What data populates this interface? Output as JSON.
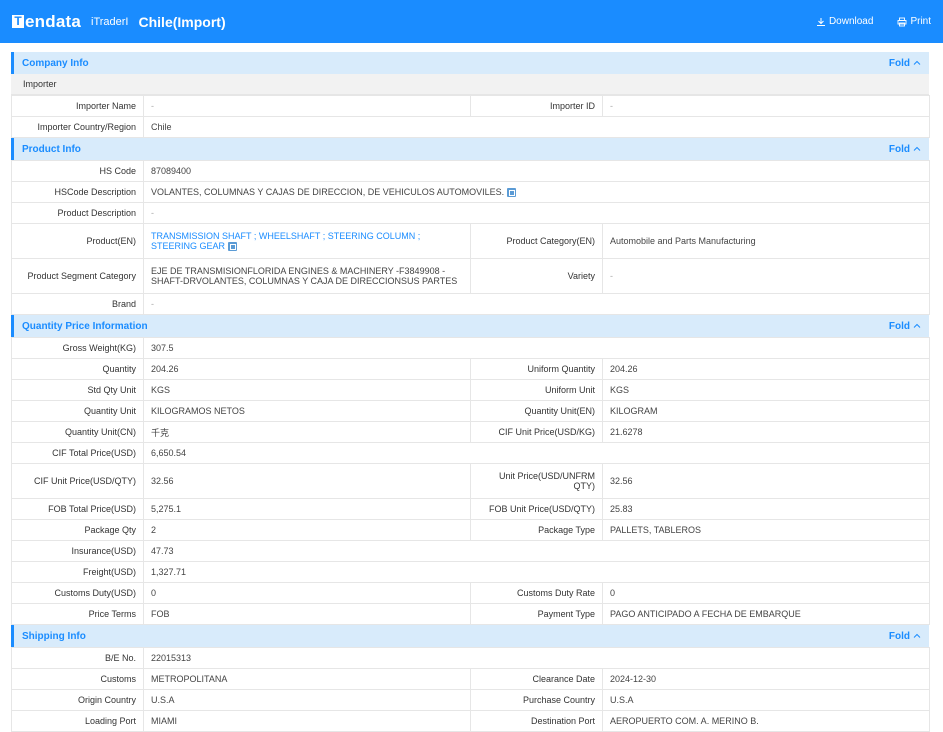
{
  "header": {
    "logo_mark": "T",
    "logo_text": "endata",
    "sub_brand": "iTraderI",
    "title": "Chile(Import)",
    "download": "Download",
    "print": "Print"
  },
  "fold_label": "Fold",
  "company": {
    "title": "Company Info",
    "subhead": "Importer",
    "rows": [
      {
        "l1": "Importer Name",
        "v1": "-",
        "l2": "Importer ID",
        "v2": "-"
      },
      {
        "l1": "Importer Country/Region",
        "v1": "Chile"
      }
    ]
  },
  "product": {
    "title": "Product Info",
    "hs_code_label": "HS Code",
    "hs_code": "87089400",
    "hs_desc_label": "HSCode Description",
    "hs_desc": "VOLANTES, COLUMNAS Y CAJAS DE DIRECCION, DE VEHICULOS AUTOMOVILES.",
    "prod_desc_label": "Product Description",
    "prod_desc": "-",
    "product_en_label": "Product(EN)",
    "product_en": "TRANSMISSION SHAFT ; WHEELSHAFT ; STEERING COLUMN ; STEERING GEAR",
    "category_en_label": "Product Category(EN)",
    "category_en": "Automobile and Parts Manufacturing",
    "segment_label": "Product Segment Category",
    "segment": "EJE DE TRANSMISIONFLORIDA ENGINES & MACHINERY -F3849908 -SHAFT-DRVOLANTES, COLUMNAS Y CAJA DE DIRECCIONSUS PARTES",
    "variety_label": "Variety",
    "variety": "-",
    "brand_label": "Brand",
    "brand": "-"
  },
  "quantity": {
    "title": "Quantity Price Information",
    "gross_weight_label": "Gross Weight(KG)",
    "gross_weight": "307.5",
    "quantity_label": "Quantity",
    "quantity": "204.26",
    "uniform_qty_label": "Uniform Quantity",
    "uniform_qty": "204.26",
    "std_unit_label": "Std Qty Unit",
    "std_unit": "KGS",
    "uniform_unit_label": "Uniform Unit",
    "uniform_unit": "KGS",
    "qty_unit_label": "Quantity Unit",
    "qty_unit": "KILOGRAMOS NETOS",
    "qty_unit_en_label": "Quantity Unit(EN)",
    "qty_unit_en": "KILOGRAM",
    "qty_unit_cn_label": "Quantity Unit(CN)",
    "qty_unit_cn": "千克",
    "cif_unit_kg_label": "CIF Unit Price(USD/KG)",
    "cif_unit_kg": "21.6278",
    "cif_total_label": "CIF Total Price(USD)",
    "cif_total": "6,650.54",
    "cif_unit_qty_label": "CIF Unit Price(USD/QTY)",
    "cif_unit_qty": "32.56",
    "unit_price_label": "Unit Price(USD/UNFRM QTY)",
    "unit_price": "32.56",
    "fob_total_label": "FOB Total Price(USD)",
    "fob_total": "5,275.1",
    "fob_unit_label": "FOB Unit Price(USD/QTY)",
    "fob_unit": "25.83",
    "pkg_qty_label": "Package Qty",
    "pkg_qty": "2",
    "pkg_type_label": "Package Type",
    "pkg_type": "PALLETS, TABLEROS",
    "insurance_label": "Insurance(USD)",
    "insurance": "47.73",
    "freight_label": "Freight(USD)",
    "freight": "1,327.71",
    "duty_label": "Customs Duty(USD)",
    "duty": "0",
    "duty_rate_label": "Customs Duty Rate",
    "duty_rate": "0",
    "price_terms_label": "Price Terms",
    "price_terms": "FOB",
    "payment_label": "Payment Type",
    "payment": "PAGO ANTICIPADO A FECHA DE EMBARQUE"
  },
  "shipping": {
    "title": "Shipping Info",
    "be_label": "B/E No.",
    "be": "22015313",
    "customs_label": "Customs",
    "customs": "METROPOLITANA",
    "clearance_label": "Clearance Date",
    "clearance": "2024-12-30",
    "origin_label": "Origin Country",
    "origin": "U.S.A",
    "purchase_label": "Purchase Country",
    "purchase": "U.S.A",
    "loading_label": "Loading Port",
    "loading": "MIAMI",
    "dest_label": "Destination Port",
    "dest": "AEROPUERTO COM. A. MERINO B."
  },
  "colors": {
    "brand": "#1a8cff",
    "section_bg": "#d8ebfb",
    "subhead_bg": "#f2f2f2"
  }
}
